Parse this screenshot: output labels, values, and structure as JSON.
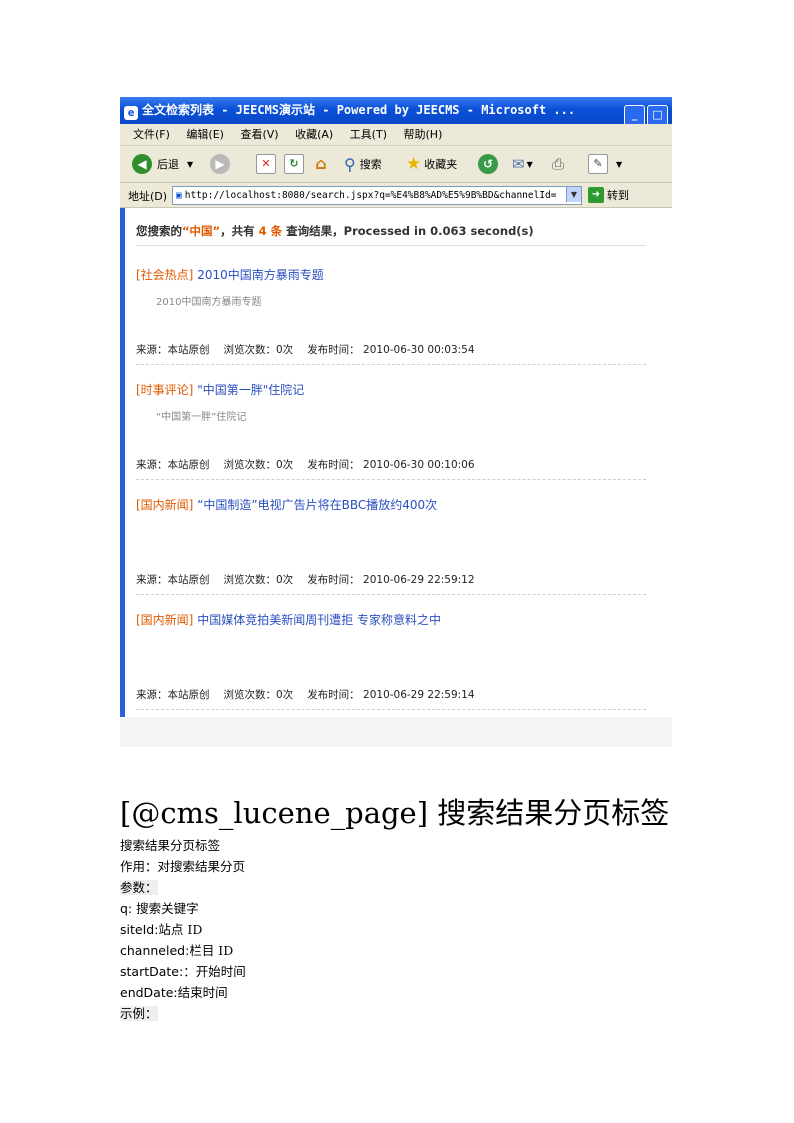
{
  "browser": {
    "title": "全文检索列表 - JEECMS演示站 - Powered by JEECMS - Microsoft ...",
    "window_buttons": [
      "_",
      "□"
    ],
    "menu": [
      "文件(F)",
      "编辑(E)",
      "查看(V)",
      "收藏(A)",
      "工具(T)",
      "帮助(H)"
    ],
    "toolbar": {
      "back": "后退",
      "search": "搜索",
      "favorites": "收藏夹"
    },
    "address_label": "地址(D)",
    "address_url": "http://localhost:8080/search.jspx?q=%E4%B8%AD%E5%9B%BD&channelId=",
    "go_label": "转到"
  },
  "summary": {
    "prefix": "您搜索的",
    "keyword": "“中国”",
    "mid": "，共有",
    "count": "4 条",
    "suffix": "查询结果，Processed in 0.063 second(s)"
  },
  "results": [
    {
      "category": "[社会热点]",
      "title": "2010中国南方暴雨专题",
      "snippet": "2010中国南方暴雨专题",
      "source": "来源：本站原创",
      "views": "浏览次数：0次",
      "time": "发布时间：  2010-06-30 00:03:54"
    },
    {
      "category": "[时事评论]",
      "title": "\"中国第一胖\"住院记",
      "snippet": "“中国第一胖”住院记",
      "source": "来源：本站原创",
      "views": "浏览次数：0次",
      "time": "发布时间：  2010-06-30 00:10:06"
    },
    {
      "category": "[国内新闻]",
      "title": "“中国制造”电视广告片将在BBC播放约400次",
      "snippet": "",
      "source": "来源：本站原创",
      "views": "浏览次数：0次",
      "time": "发布时间：  2010-06-29 22:59:12"
    },
    {
      "category": "[国内新闻]",
      "title": "中国媒体竞拍美新闻周刊遭拒 专家称意料之中",
      "snippet": "",
      "source": "来源：本站原创",
      "views": "浏览次数：0次",
      "time": "发布时间：  2010-06-29 22:59:14"
    }
  ],
  "doc": {
    "heading": "[@cms_lucene_page] 搜索结果分页标签",
    "lines": [
      {
        "label": "",
        "text": "搜索结果分页标签"
      },
      {
        "label": "",
        "text": "作用：对搜索结果分页"
      },
      {
        "label": "",
        "text": "参数："
      },
      {
        "label": "q:",
        "text": "  搜索关键字"
      },
      {
        "label": "siteId:",
        "text": "站点 ID"
      },
      {
        "label": "channeled:",
        "text": "栏目 ID"
      },
      {
        "label": "startDate:",
        "text": "：开始时间"
      },
      {
        "label": "endDate:",
        "text": "结束时间"
      },
      {
        "label": "",
        "text": "示例："
      }
    ]
  }
}
